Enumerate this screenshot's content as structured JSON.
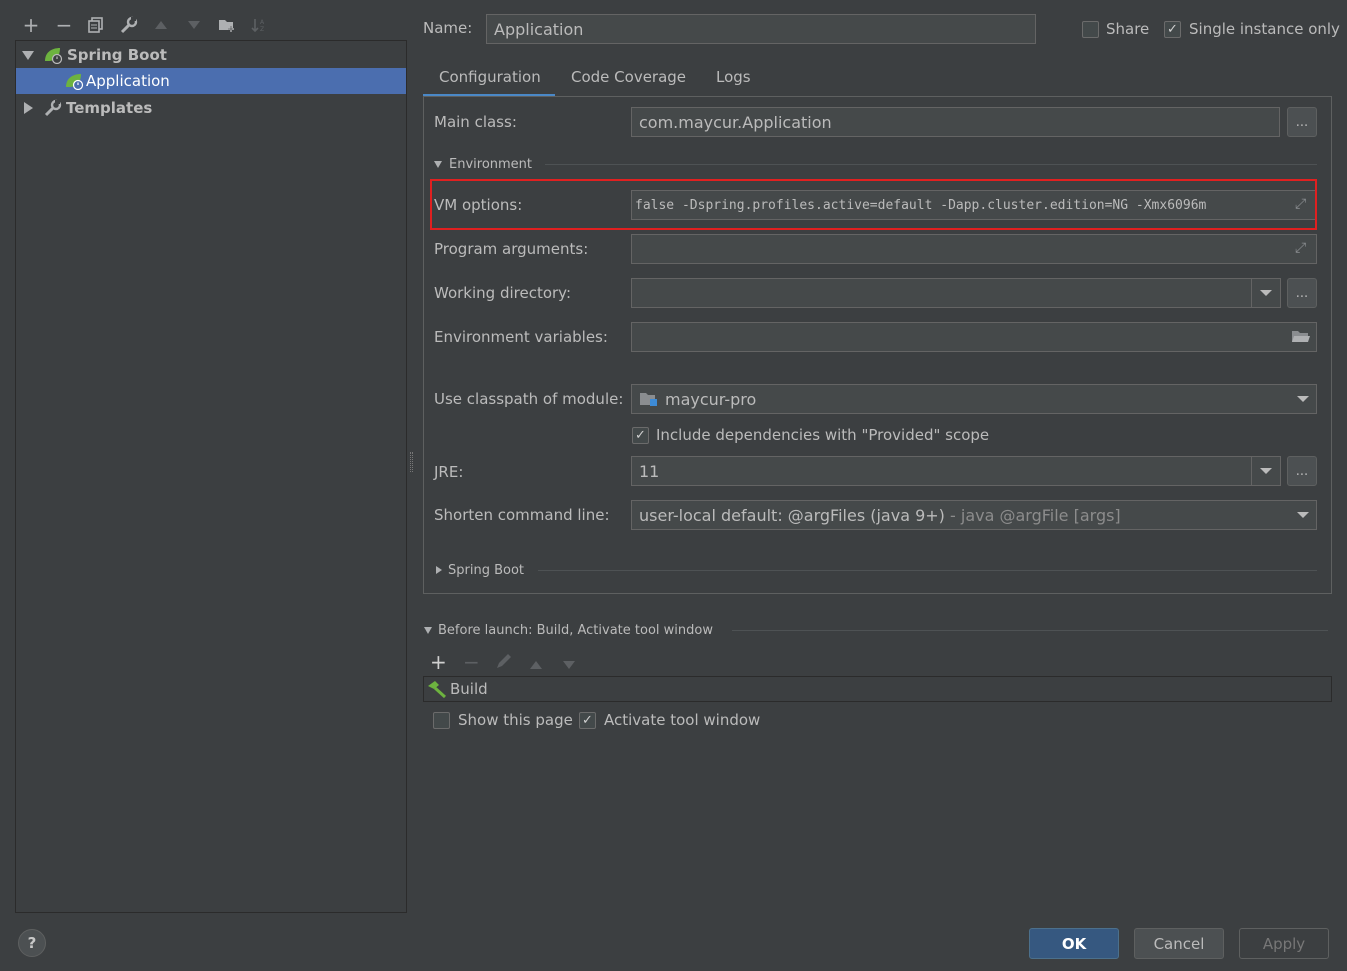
{
  "toolbar": {
    "icons": [
      "add-icon",
      "remove-icon",
      "copy-icon",
      "wrench-icon",
      "move-up-icon",
      "move-down-icon",
      "new-folder-icon",
      "sort-icon"
    ]
  },
  "tree": {
    "items": [
      {
        "label": "Spring Boot",
        "expanded": true,
        "bold": true
      },
      {
        "label": "Application",
        "selected": true
      },
      {
        "label": "Templates",
        "expanded": false,
        "bold": true
      }
    ]
  },
  "header": {
    "name_label": "Name:",
    "name_value": "Application",
    "share_label": "Share",
    "share_checked": false,
    "single_instance_label": "Single instance only",
    "single_instance_checked": true
  },
  "tabs": [
    {
      "label": "Configuration",
      "active": true
    },
    {
      "label": "Code Coverage"
    },
    {
      "label": "Logs"
    }
  ],
  "config": {
    "main_class_label": "Main class:",
    "main_class_value": "com.maycur.Application",
    "environment_label": "Environment",
    "vm_options_label": "VM options:",
    "vm_options_value": "false -Dspring.profiles.active=default -Dapp.cluster.edition=NG -Xmx6096m",
    "program_args_label": "Program arguments:",
    "working_dir_label": "Working directory:",
    "env_vars_label": "Environment variables:",
    "classpath_label": "Use classpath of module:",
    "classpath_value": "maycur-pro",
    "include_deps_label": "Include dependencies with \"Provided\" scope",
    "include_deps_checked": true,
    "jre_label": "JRE:",
    "jre_value": "11",
    "shorten_label": "Shorten command line:",
    "shorten_value": "user-local default: @argFiles (java 9+)",
    "shorten_hint": " - java @argFile [args]",
    "spring_boot_section": "Spring Boot"
  },
  "before_launch": {
    "title": "Before launch: Build, Activate tool window",
    "items": [
      "Build"
    ],
    "show_page_label": "Show this page",
    "show_page_checked": false,
    "activate_label": "Activate tool window",
    "activate_checked": true
  },
  "footer": {
    "help": "?",
    "ok": "OK",
    "cancel": "Cancel",
    "apply": "Apply"
  },
  "colors": {
    "background": "#3c3f41",
    "selection": "#4b6eaf",
    "highlight_border": "#e02020",
    "spring_green": "#6db33f"
  }
}
